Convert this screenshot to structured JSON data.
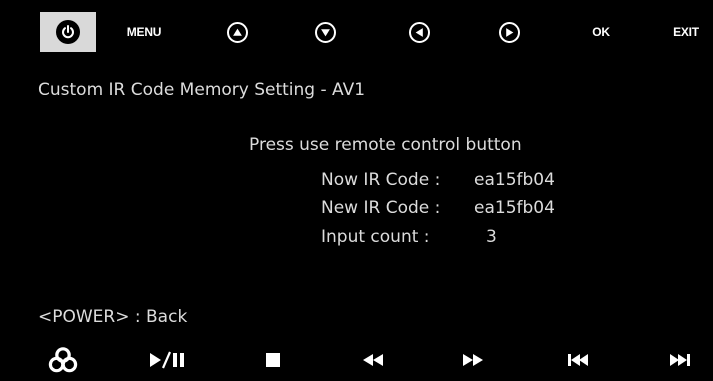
{
  "top_controls": {
    "power_icon": "power-icon",
    "menu_label": "MENU",
    "up_icon": "up-arrow-circle-icon",
    "down_icon": "down-arrow-circle-icon",
    "left_icon": "left-arrow-circle-icon",
    "right_icon": "right-arrow-circle-icon",
    "ok_label": "OK",
    "exit_label": "EXIT"
  },
  "screen": {
    "title": "Custom IR Code Memory Setting - AV1",
    "instruction": "Press use remote control button",
    "now_label": "Now IR Code :",
    "now_value": "ea15fb04",
    "new_label": "New IR Code :",
    "new_value": "ea15fb04",
    "count_label": "Input count :",
    "count_value": "3",
    "back_hint": "<POWER> : Back"
  },
  "bottom_controls": {
    "icons": [
      "source-icon",
      "play-pause-icon",
      "stop-icon",
      "rewind-icon",
      "fast-forward-icon",
      "previous-track-icon",
      "next-track-icon"
    ]
  },
  "colors": {
    "background": "#000000",
    "text": "#dcdcdc",
    "power_button_bg": "#d9d9d9"
  }
}
